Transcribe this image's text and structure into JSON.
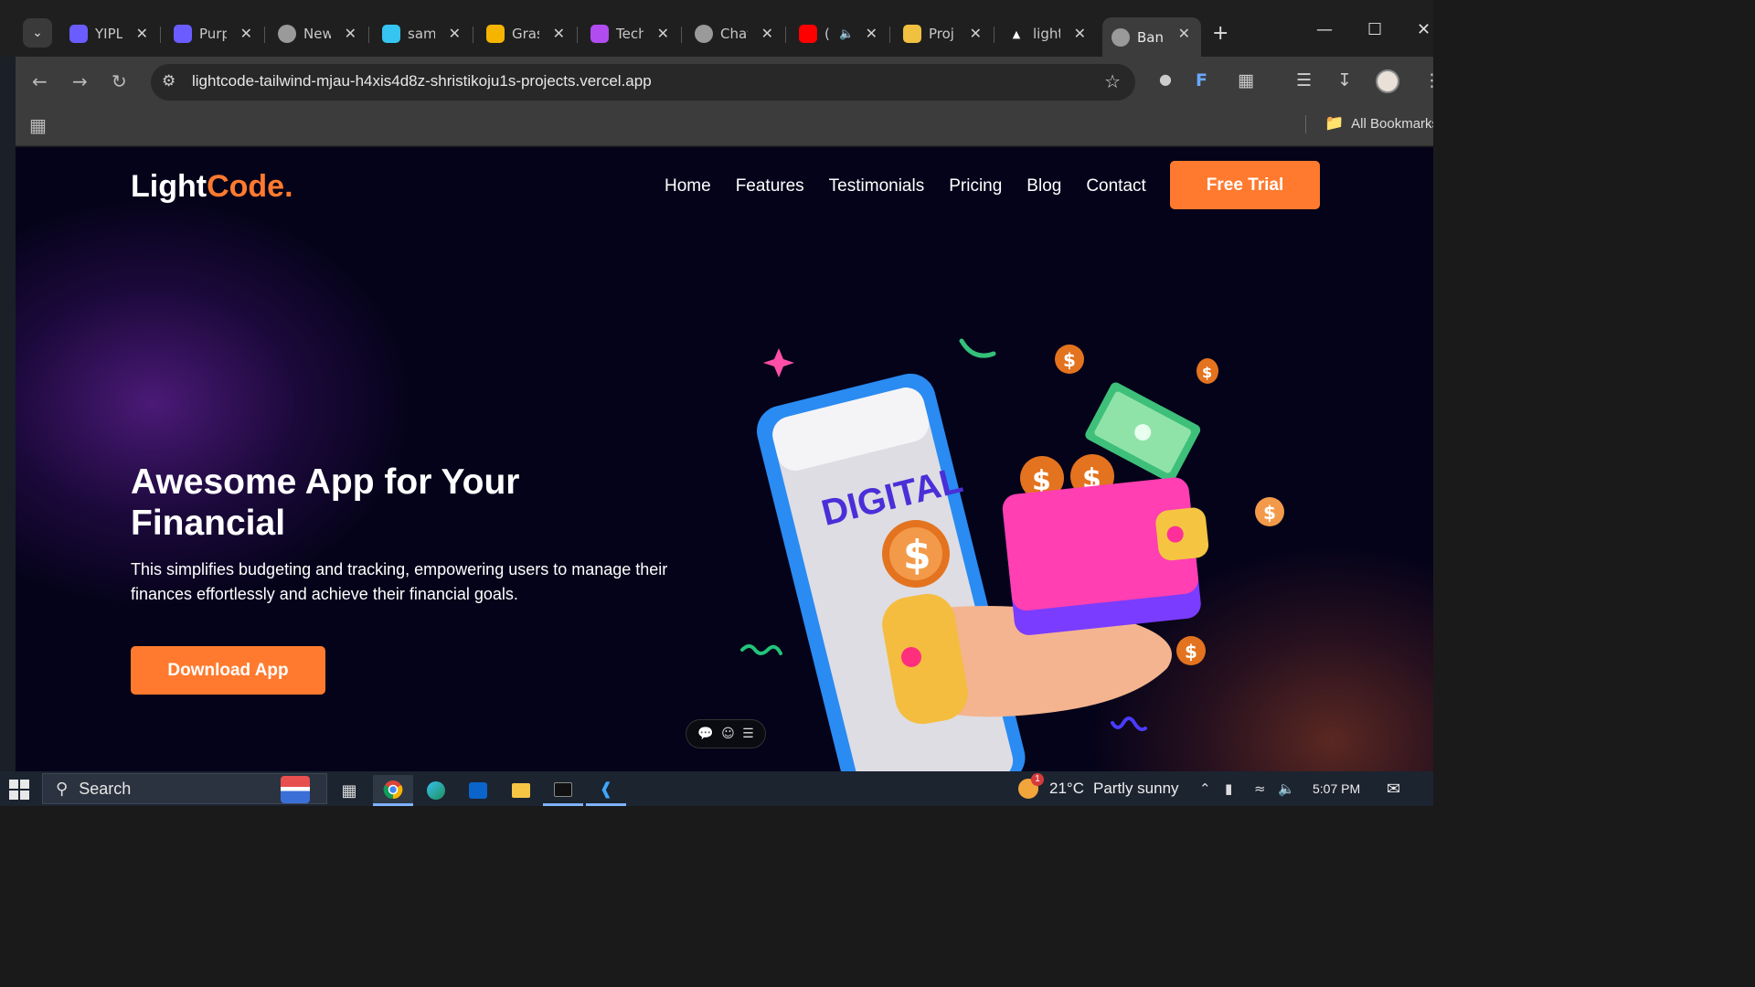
{
  "browser": {
    "tabs": [
      {
        "label": "YIPL",
        "favicon_color": "#6a5cff",
        "active": false
      },
      {
        "label": "Purp",
        "favicon_color": "#6a5cff",
        "active": false
      },
      {
        "label": "New",
        "favicon_color": "#9a9a9a",
        "active": false
      },
      {
        "label": "sam",
        "favicon_color": "#36c5f0",
        "active": false
      },
      {
        "label": "Gras",
        "favicon_color": "#f5b400",
        "active": false
      },
      {
        "label": "Tech",
        "favicon_color": "#b04cf0",
        "active": false
      },
      {
        "label": "Chat",
        "favicon_color": "#9a9a9a",
        "active": false
      },
      {
        "label": "(",
        "favicon_color": "#ff0000",
        "active": false
      },
      {
        "label": "Proj",
        "favicon_color": "#f0c040",
        "active": false
      },
      {
        "label": "light",
        "favicon_color": "#ffffff",
        "active": false
      },
      {
        "label": "Bank",
        "favicon_color": "#9a9a9a",
        "active": true
      }
    ],
    "url": "lightcode-tailwind-mjau-h4xis4d8z-shristikoju1s-projects.vercel.app",
    "bookmarks_label": "All Bookmarks"
  },
  "site": {
    "logo_main": "Light",
    "logo_accent": "Code.",
    "nav": [
      "Home",
      "Features",
      "Testimonials",
      "Pricing",
      "Blog",
      "Contact"
    ],
    "cta_label": "Free Trial",
    "hero_title": "Awesome App for Your Financial",
    "hero_description": "This simplifies budgeting and tracking, empowering users to manage their finances effortlessly and achieve their financial goals.",
    "download_label": "Download App",
    "illustration_text": "DIGITAL",
    "accent_color": "#ff7a2e",
    "background_color": "#05031a"
  },
  "taskbar": {
    "search_placeholder": "Search",
    "weather_temp": "21°C",
    "weather_condition": "Partly sunny",
    "weather_badge": "1",
    "time": "5:07 PM"
  }
}
